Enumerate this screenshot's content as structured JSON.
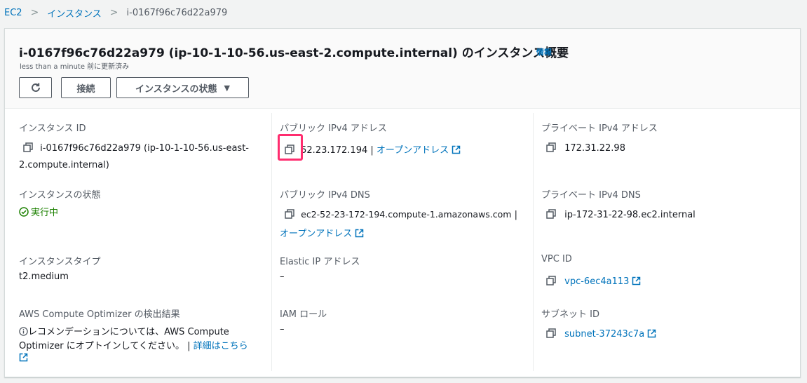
{
  "breadcrumb": {
    "items": [
      "EC2",
      "インスタンス",
      "i-0167f96c76d22a979"
    ]
  },
  "header": {
    "title": "i-0167f96c76d22a979 (ip-10-1-10-56.us-east-2.compute.internal) のインスタンス概要",
    "info_label": "情報",
    "updated": "less than a minute 前に更新済み",
    "connect_label": "接続",
    "state_label": "インスタンスの状態"
  },
  "col1": {
    "instance_id_label": "インスタンス ID",
    "instance_id_value_line1": "i-0167f96c76d22a979 (ip-10-1-10-56.us-east-",
    "instance_id_value_line2": "2.compute.internal)",
    "state_label": "インスタンスの状態",
    "state_value": "実行中",
    "type_label": "インスタンスタイプ",
    "type_value": "t2.medium",
    "optimizer_label": "AWS Compute Optimizer の検出結果",
    "optimizer_text_line1": "レコメンデーションについては、AWS Compute",
    "optimizer_text_line2": "Optimizer にオプトインしてください。 |",
    "optimizer_link": "詳細はこちら"
  },
  "col2": {
    "public_ip_label": "パブリック IPv4 アドレス",
    "public_ip_value": "52.23.172.194",
    "public_ip_sep": "|",
    "open_address_label": "オープンアドレス",
    "public_dns_label": "パブリック IPv4 DNS",
    "public_dns_value": "ec2-52-23-172-194.compute-1.amazonaws.com",
    "public_dns_sep": "|",
    "open_address_label2": "オープンアドレス",
    "elastic_ip_label": "Elastic IP アドレス",
    "elastic_ip_value": "–",
    "iam_role_label": "IAM ロール",
    "iam_role_value": "–"
  },
  "col3": {
    "private_ip_label": "プライベート IPv4 アドレス",
    "private_ip_value": "172.31.22.98",
    "private_dns_label": "プライベート IPv4 DNS",
    "private_dns_value": "ip-172-31-22-98.ec2.internal",
    "vpc_label": "VPC ID",
    "vpc_value": "vpc-6ec4a113",
    "subnet_label": "サブネット ID",
    "subnet_value": "subnet-37243c7a"
  },
  "colors": {
    "link": "#0073bb",
    "running": "#1d8102",
    "highlight": "#ff2d6f"
  }
}
